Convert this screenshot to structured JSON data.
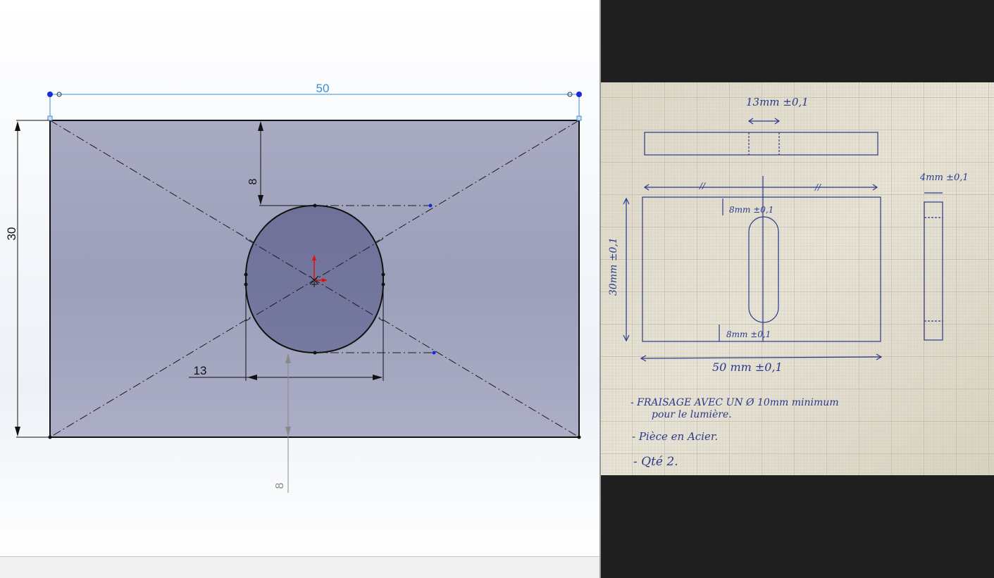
{
  "cad": {
    "dimensions": {
      "width": "50",
      "height": "30",
      "top_offset": "8",
      "circle_offset": "13",
      "bottom_offset": "8"
    },
    "colors": {
      "part_fill": "#a4a7c0",
      "circle_fill": "#71739a",
      "dimension_blue": "#3a8fd4",
      "point_blue": "#1a2bd6"
    }
  },
  "drawing": {
    "top_dim": "13mm ±0,1",
    "mid_left_tick": "//",
    "mid_right_tick": "//",
    "side_dim": "4mm ±0,1",
    "slot_top_dim": "8mm ±0,1",
    "slot_bottom_dim": "8mm ±0,1",
    "height_dim": "30mm ±0,1",
    "width_dim": "50 mm ±0,1",
    "notes": [
      "- FRAISAGE AVEC UN Ø 10mm minimum",
      "pour le lumière.",
      "- Pièce en Acier.",
      "- Qté 2."
    ]
  }
}
